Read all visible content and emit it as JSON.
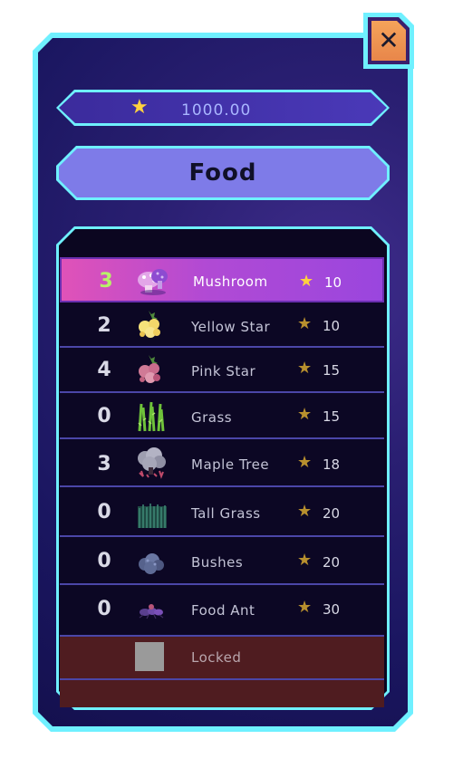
{
  "currency": {
    "icon": "star-icon",
    "value": "1000.00"
  },
  "category": {
    "title": "Food"
  },
  "close": {
    "icon": "close-icon",
    "label": "✕"
  },
  "colors": {
    "accent_cyan": "#6ff0ff",
    "selected_gradient_start": "#e052b8",
    "selected_gradient_end": "#9a46de",
    "count_highlight": "#b8f06a",
    "star_gold": "#ffd23f",
    "locked_bg": "#4f1c20"
  },
  "items": [
    {
      "count": "3",
      "name": "Mushroom",
      "price": "10",
      "icon": "mushroom-icon",
      "selected": true
    },
    {
      "count": "2",
      "name": "Yellow Star",
      "price": "10",
      "icon": "yellow-star-plant-icon",
      "selected": false
    },
    {
      "count": "4",
      "name": "Pink Star",
      "price": "15",
      "icon": "pink-star-plant-icon",
      "selected": false
    },
    {
      "count": "0",
      "name": "Grass",
      "price": "15",
      "icon": "grass-icon",
      "selected": false
    },
    {
      "count": "3",
      "name": "Maple Tree",
      "price": "18",
      "icon": "maple-tree-icon",
      "selected": false
    },
    {
      "count": "0",
      "name": "Tall Grass",
      "price": "20",
      "icon": "tall-grass-icon",
      "selected": false
    },
    {
      "count": "0",
      "name": "Bushes",
      "price": "20",
      "icon": "bushes-icon",
      "selected": false
    },
    {
      "count": "0",
      "name": "Food Ant",
      "price": "30",
      "icon": "food-ant-icon",
      "selected": false
    }
  ],
  "locked": {
    "label": "Locked",
    "icon": "locked-placeholder-icon"
  },
  "price_icon": "star-icon"
}
